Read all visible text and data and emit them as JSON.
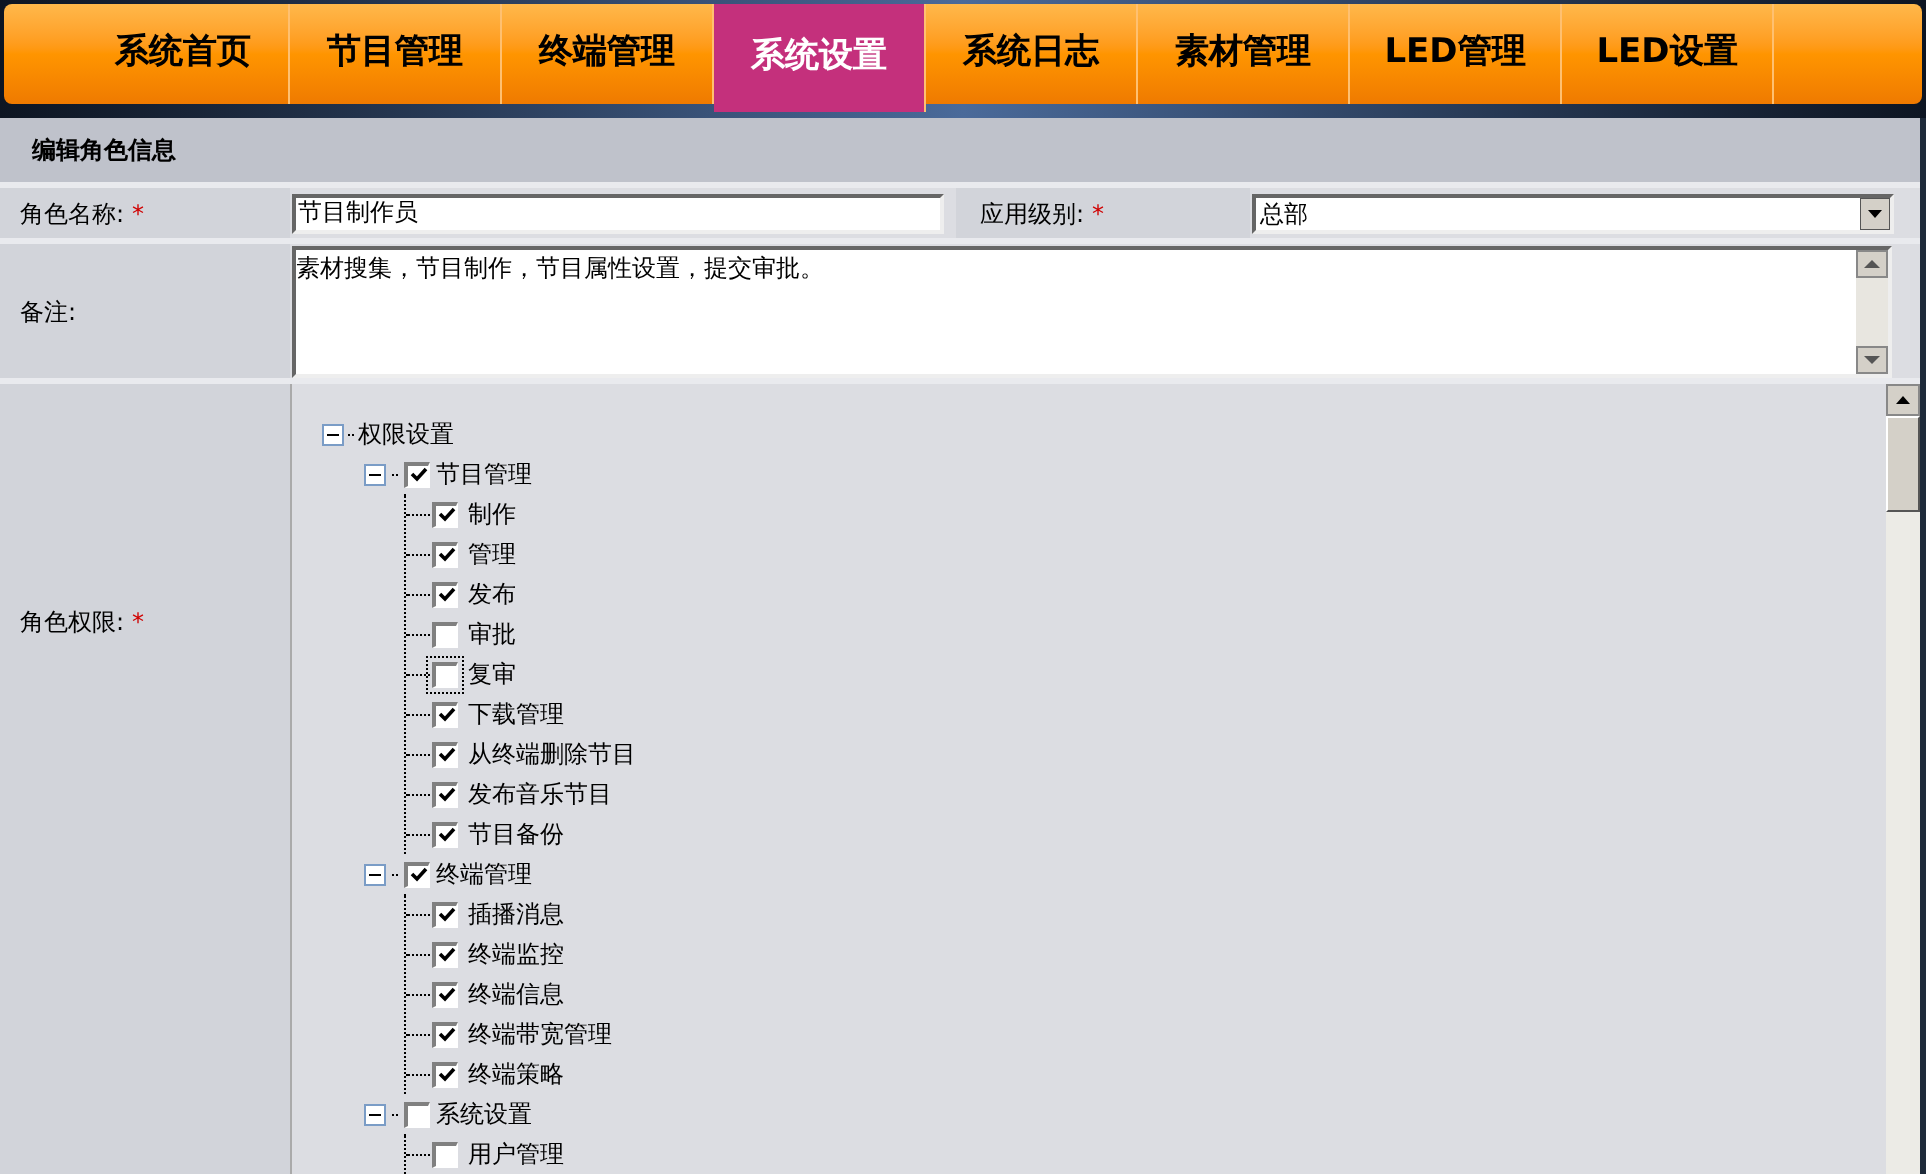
{
  "nav": {
    "tabs": [
      {
        "label": "系统首页",
        "selected": false
      },
      {
        "label": "节目管理",
        "selected": false
      },
      {
        "label": "终端管理",
        "selected": false
      },
      {
        "label": "系统设置",
        "selected": true
      },
      {
        "label": "系统日志",
        "selected": false
      },
      {
        "label": "素材管理",
        "selected": false
      },
      {
        "label": "LED管理",
        "selected": false
      },
      {
        "label": "LED设置",
        "selected": false
      }
    ]
  },
  "form": {
    "title": "编辑角色信息",
    "name_label": "角色名称:",
    "name_required": "*",
    "name_value": "节目制作员",
    "level_label": "应用级别:",
    "level_required": "*",
    "level_value": "总部",
    "remark_label": "备注:",
    "remark_value": "素材搜集，节目制作，节目属性设置，提交审批。",
    "perm_label": "角色权限:",
    "perm_required": "*",
    "tree": {
      "label": "权限设置",
      "expanded": true,
      "children": [
        {
          "label": "节目管理",
          "checked": true,
          "expanded": true,
          "children": [
            {
              "label": "制作",
              "checked": true,
              "focused": false
            },
            {
              "label": "管理",
              "checked": true,
              "focused": false
            },
            {
              "label": "发布",
              "checked": true,
              "focused": false
            },
            {
              "label": "审批",
              "checked": false,
              "focused": false
            },
            {
              "label": "复审",
              "checked": false,
              "focused": true
            },
            {
              "label": "下载管理",
              "checked": true,
              "focused": false
            },
            {
              "label": "从终端删除节目",
              "checked": true,
              "focused": false
            },
            {
              "label": "发布音乐节目",
              "checked": true,
              "focused": false
            },
            {
              "label": "节目备份",
              "checked": true,
              "focused": false
            }
          ]
        },
        {
          "label": "终端管理",
          "checked": true,
          "expanded": true,
          "children": [
            {
              "label": "插播消息",
              "checked": true,
              "focused": false
            },
            {
              "label": "终端监控",
              "checked": true,
              "focused": false
            },
            {
              "label": "终端信息",
              "checked": true,
              "focused": false
            },
            {
              "label": "终端带宽管理",
              "checked": true,
              "focused": false
            },
            {
              "label": "终端策略",
              "checked": true,
              "focused": false
            }
          ]
        },
        {
          "label": "系统设置",
          "checked": false,
          "expanded": true,
          "children": [
            {
              "label": "用户管理",
              "checked": false,
              "focused": false
            }
          ]
        }
      ]
    }
  }
}
